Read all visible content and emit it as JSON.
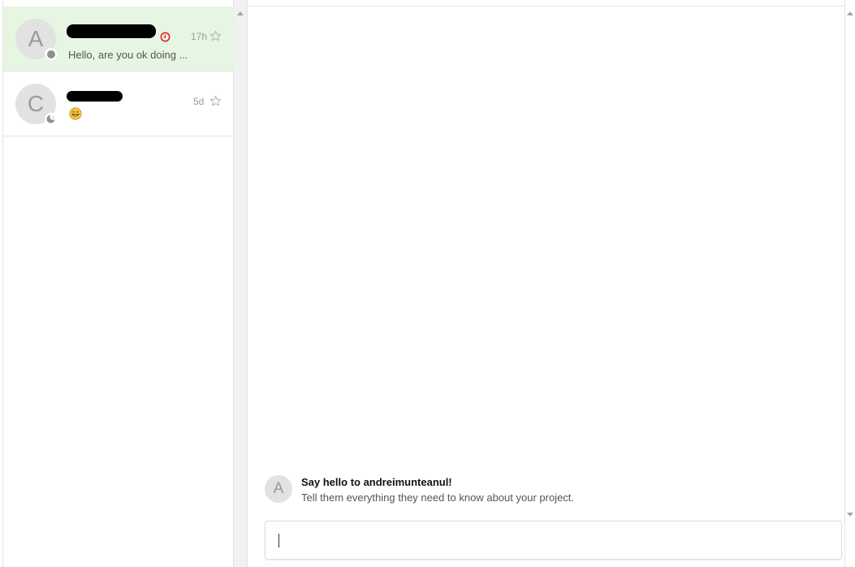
{
  "conversations": [
    {
      "avatar_letter": "A",
      "timestamp": "17h",
      "preview": "Hello, are you ok doing ...",
      "status": "offline",
      "active": true
    },
    {
      "avatar_letter": "C",
      "timestamp": "5d",
      "preview_icon": "grinning-face-emoji-icon",
      "status": "away",
      "active": false
    }
  ],
  "chat": {
    "intro_avatar_letter": "A",
    "intro_title": "Say hello to andreimunteanul!",
    "intro_subtitle": "Tell them everything they need to know about your project.",
    "composer_value": ""
  },
  "colors": {
    "active_row": "#e6f6e3",
    "timer_red": "#e0241b",
    "border": "#e3e3e3"
  }
}
